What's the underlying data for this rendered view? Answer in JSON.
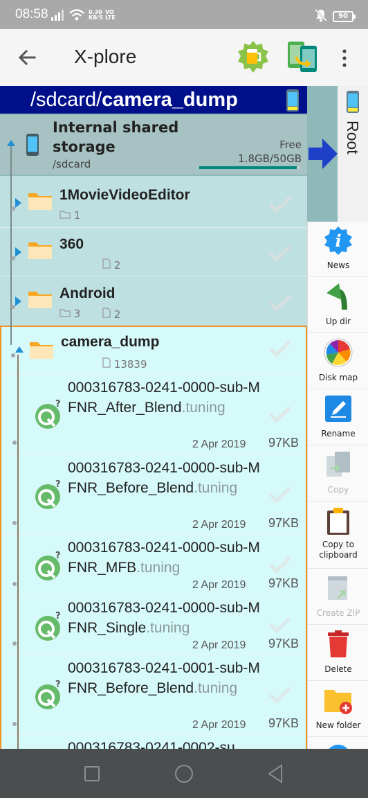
{
  "status": {
    "time": "08:58",
    "speed_top": "0.30",
    "speed_bottom": "KB/S",
    "volte_top": "VO",
    "volte_bottom": "LTE",
    "battery": "90"
  },
  "appbar": {
    "title": "X-plore"
  },
  "path": {
    "prefix": "/sdcard/",
    "current": "camera_dump"
  },
  "storage": {
    "name": "Internal shared storage",
    "path": "/sdcard",
    "free_label": "Free",
    "size": "1.8GB/50GB",
    "used_fraction": 0.964
  },
  "folders": [
    {
      "name": "1MovieVideoEditor",
      "dirs": "1",
      "files": ""
    },
    {
      "name": "360",
      "dirs": "",
      "files": "2"
    },
    {
      "name": "Android",
      "dirs": "3",
      "files": "2"
    }
  ],
  "camera": {
    "name": "camera_dump",
    "files": "13839"
  },
  "files": [
    {
      "base": "000316783-0241-0000-sub-MFNR_After_Blend",
      "ext": ".tuning",
      "date": "2 Apr 2019",
      "size": "97KB"
    },
    {
      "base": "000316783-0241-0000-sub-MFNR_Before_Blend",
      "ext": ".tuning",
      "date": "2 Apr 2019",
      "size": "97KB"
    },
    {
      "base": "000316783-0241-0000-sub-MFNR_MFB",
      "ext": ".tuning",
      "date": "2 Apr 2019",
      "size": "97KB"
    },
    {
      "base": "000316783-0241-0000-sub-MFNR_Single",
      "ext": ".tuning",
      "date": "2 Apr 2019",
      "size": "97KB"
    },
    {
      "base": "000316783-0241-0001-sub-MFNR_Before_Blend",
      "ext": ".tuning",
      "date": "2 Apr 2019",
      "size": "97KB"
    },
    {
      "base": "000316783-0241-0002-su",
      "ext": "",
      "date": "",
      "size": ""
    }
  ],
  "root_tab": {
    "label": "Root"
  },
  "toolbar": {
    "news": "News",
    "updir": "Up dir",
    "diskmap": "Disk map",
    "rename": "Rename",
    "copy": "Copy",
    "copy_clip_1": "Copy to",
    "copy_clip_2": "clipboard",
    "create_zip": "Create ZIP",
    "delete": "Delete",
    "new_folder": "New folder"
  },
  "colors": {
    "path_bar": "#000f8a",
    "panel": "#8fb8b8",
    "selected_panel": "#d6f9f9",
    "selection_border": "#f29322",
    "accent_blue": "#1f8fd6"
  }
}
